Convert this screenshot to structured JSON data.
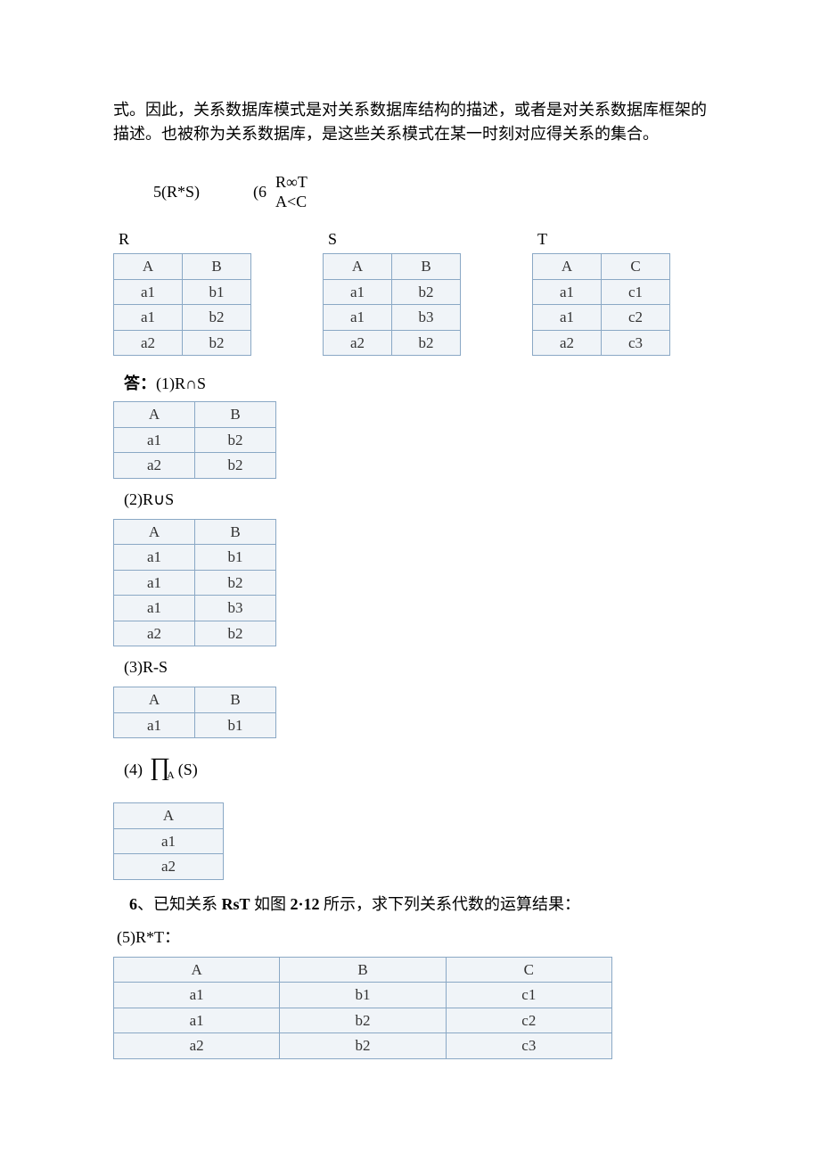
{
  "intro": "式。因此，关系数据库模式是对关系数据库结构的描述，或者是对关系数据库框架的描述。也被称为关系数据库，是这些关系模式在某一时刻对应得关系的集合。",
  "q5": "5(R*S)",
  "q6paren": "(6",
  "q6top": "R∞T",
  "q6bot": "A<C",
  "labelR": "R",
  "labelS": "S",
  "labelT": "T",
  "col_A": "A",
  "col_B": "B",
  "col_C": "C",
  "tableR": [
    [
      "a1",
      "b1"
    ],
    [
      "a1",
      "b2"
    ],
    [
      "a2",
      "b2"
    ]
  ],
  "tableS": [
    [
      "a1",
      "b2"
    ],
    [
      "a1",
      "b3"
    ],
    [
      "a2",
      "b2"
    ]
  ],
  "tableT": [
    [
      "a1",
      "c1"
    ],
    [
      "a1",
      "c2"
    ],
    [
      "a2",
      "c3"
    ]
  ],
  "ans_prefix": "答：",
  "ans1_label": "(1)R∩S",
  "ans1": [
    [
      "a1",
      "b2"
    ],
    [
      "a2",
      "b2"
    ]
  ],
  "ans2_label": "(2)R∪S",
  "ans2": [
    [
      "a1",
      "b1"
    ],
    [
      "a1",
      "b2"
    ],
    [
      "a1",
      "b3"
    ],
    [
      "a2",
      "b2"
    ]
  ],
  "ans3_label": "(3)R-S",
  "ans3": [
    [
      "a1",
      "b1"
    ]
  ],
  "ans4_num": "(4)",
  "ans4_pi": "∏",
  "ans4_sub": "A",
  "ans4_suf": "(S)",
  "ans4": [
    [
      "a1"
    ],
    [
      "a2"
    ]
  ],
  "q6_num": "6",
  "q6_sep": "、",
  "q6_pref": "已知关系",
  "q6_bold": "RsT",
  "q6_mid1": "如图",
  "q6_bold2": "2·12",
  "q6_suf": "所示，求下列关系代数的运算结果：",
  "ans5_label": "(5)R*T：",
  "ans5": [
    [
      "a1",
      "b1",
      "c1"
    ],
    [
      "a1",
      "b2",
      "c2"
    ],
    [
      "a2",
      "b2",
      "c3"
    ]
  ]
}
